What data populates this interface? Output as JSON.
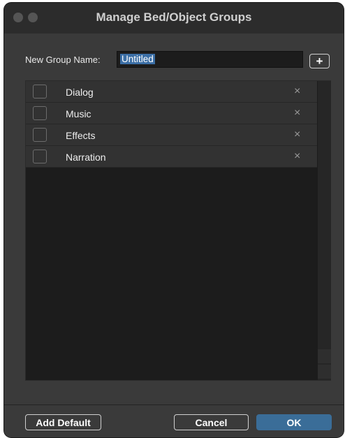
{
  "window": {
    "title": "Manage Bed/Object Groups"
  },
  "form": {
    "new_group_label": "New Group Name:",
    "new_group_value": "Untitled",
    "add_button_glyph": "+"
  },
  "groups": [
    {
      "name": "Dialog",
      "checked": false,
      "delete_glyph": "×"
    },
    {
      "name": "Music",
      "checked": false,
      "delete_glyph": "×"
    },
    {
      "name": "Effects",
      "checked": false,
      "delete_glyph": "×"
    },
    {
      "name": "Narration",
      "checked": false,
      "delete_glyph": "×"
    }
  ],
  "footer": {
    "add_default_label": "Add Default",
    "cancel_label": "Cancel",
    "ok_label": "OK"
  },
  "colors": {
    "background": "#3a3a3a",
    "list_background": "#1c1c1c",
    "accent": "#3a6d98",
    "selection": "#3b6ea5"
  }
}
